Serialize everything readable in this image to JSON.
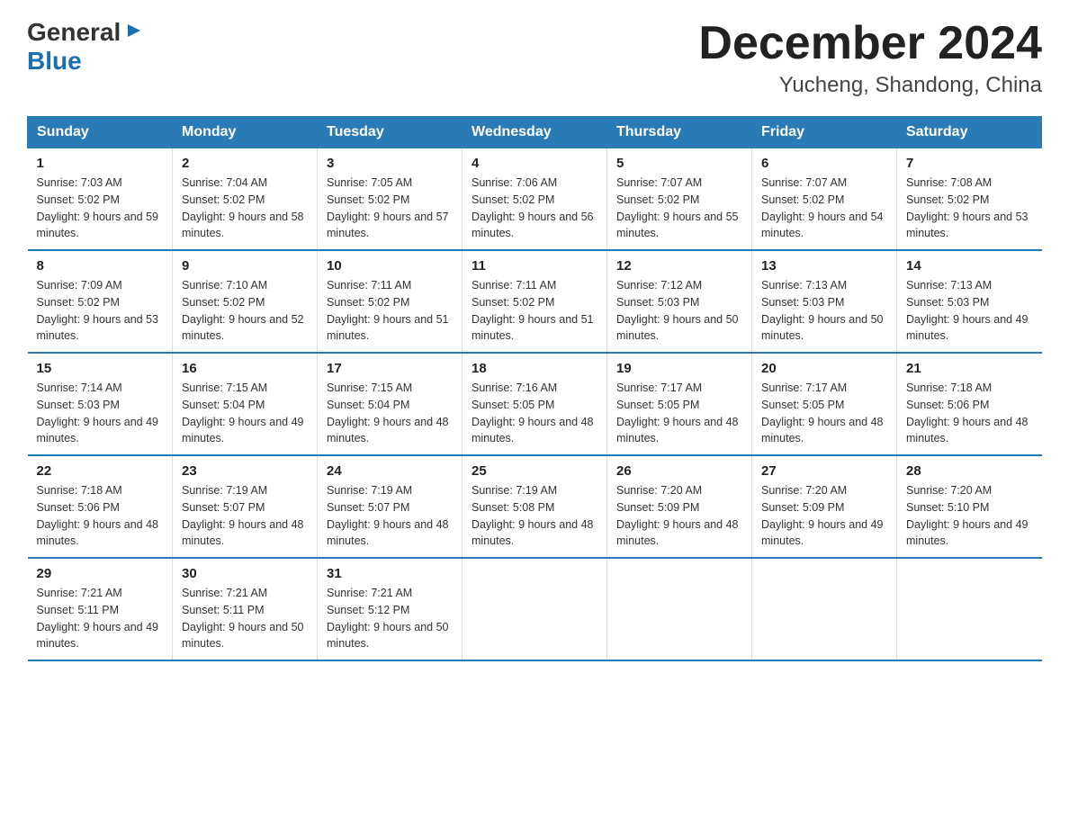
{
  "logo": {
    "general": "General",
    "blue": "Blue",
    "arrow": "▶"
  },
  "title": "December 2024",
  "location": "Yucheng, Shandong, China",
  "days_of_week": [
    "Sunday",
    "Monday",
    "Tuesday",
    "Wednesday",
    "Thursday",
    "Friday",
    "Saturday"
  ],
  "weeks": [
    [
      {
        "day": "1",
        "sunrise": "7:03 AM",
        "sunset": "5:02 PM",
        "daylight": "9 hours and 59 minutes."
      },
      {
        "day": "2",
        "sunrise": "7:04 AM",
        "sunset": "5:02 PM",
        "daylight": "9 hours and 58 minutes."
      },
      {
        "day": "3",
        "sunrise": "7:05 AM",
        "sunset": "5:02 PM",
        "daylight": "9 hours and 57 minutes."
      },
      {
        "day": "4",
        "sunrise": "7:06 AM",
        "sunset": "5:02 PM",
        "daylight": "9 hours and 56 minutes."
      },
      {
        "day": "5",
        "sunrise": "7:07 AM",
        "sunset": "5:02 PM",
        "daylight": "9 hours and 55 minutes."
      },
      {
        "day": "6",
        "sunrise": "7:07 AM",
        "sunset": "5:02 PM",
        "daylight": "9 hours and 54 minutes."
      },
      {
        "day": "7",
        "sunrise": "7:08 AM",
        "sunset": "5:02 PM",
        "daylight": "9 hours and 53 minutes."
      }
    ],
    [
      {
        "day": "8",
        "sunrise": "7:09 AM",
        "sunset": "5:02 PM",
        "daylight": "9 hours and 53 minutes."
      },
      {
        "day": "9",
        "sunrise": "7:10 AM",
        "sunset": "5:02 PM",
        "daylight": "9 hours and 52 minutes."
      },
      {
        "day": "10",
        "sunrise": "7:11 AM",
        "sunset": "5:02 PM",
        "daylight": "9 hours and 51 minutes."
      },
      {
        "day": "11",
        "sunrise": "7:11 AM",
        "sunset": "5:02 PM",
        "daylight": "9 hours and 51 minutes."
      },
      {
        "day": "12",
        "sunrise": "7:12 AM",
        "sunset": "5:03 PM",
        "daylight": "9 hours and 50 minutes."
      },
      {
        "day": "13",
        "sunrise": "7:13 AM",
        "sunset": "5:03 PM",
        "daylight": "9 hours and 50 minutes."
      },
      {
        "day": "14",
        "sunrise": "7:13 AM",
        "sunset": "5:03 PM",
        "daylight": "9 hours and 49 minutes."
      }
    ],
    [
      {
        "day": "15",
        "sunrise": "7:14 AM",
        "sunset": "5:03 PM",
        "daylight": "9 hours and 49 minutes."
      },
      {
        "day": "16",
        "sunrise": "7:15 AM",
        "sunset": "5:04 PM",
        "daylight": "9 hours and 49 minutes."
      },
      {
        "day": "17",
        "sunrise": "7:15 AM",
        "sunset": "5:04 PM",
        "daylight": "9 hours and 48 minutes."
      },
      {
        "day": "18",
        "sunrise": "7:16 AM",
        "sunset": "5:05 PM",
        "daylight": "9 hours and 48 minutes."
      },
      {
        "day": "19",
        "sunrise": "7:17 AM",
        "sunset": "5:05 PM",
        "daylight": "9 hours and 48 minutes."
      },
      {
        "day": "20",
        "sunrise": "7:17 AM",
        "sunset": "5:05 PM",
        "daylight": "9 hours and 48 minutes."
      },
      {
        "day": "21",
        "sunrise": "7:18 AM",
        "sunset": "5:06 PM",
        "daylight": "9 hours and 48 minutes."
      }
    ],
    [
      {
        "day": "22",
        "sunrise": "7:18 AM",
        "sunset": "5:06 PM",
        "daylight": "9 hours and 48 minutes."
      },
      {
        "day": "23",
        "sunrise": "7:19 AM",
        "sunset": "5:07 PM",
        "daylight": "9 hours and 48 minutes."
      },
      {
        "day": "24",
        "sunrise": "7:19 AM",
        "sunset": "5:07 PM",
        "daylight": "9 hours and 48 minutes."
      },
      {
        "day": "25",
        "sunrise": "7:19 AM",
        "sunset": "5:08 PM",
        "daylight": "9 hours and 48 minutes."
      },
      {
        "day": "26",
        "sunrise": "7:20 AM",
        "sunset": "5:09 PM",
        "daylight": "9 hours and 48 minutes."
      },
      {
        "day": "27",
        "sunrise": "7:20 AM",
        "sunset": "5:09 PM",
        "daylight": "9 hours and 49 minutes."
      },
      {
        "day": "28",
        "sunrise": "7:20 AM",
        "sunset": "5:10 PM",
        "daylight": "9 hours and 49 minutes."
      }
    ],
    [
      {
        "day": "29",
        "sunrise": "7:21 AM",
        "sunset": "5:11 PM",
        "daylight": "9 hours and 49 minutes."
      },
      {
        "day": "30",
        "sunrise": "7:21 AM",
        "sunset": "5:11 PM",
        "daylight": "9 hours and 50 minutes."
      },
      {
        "day": "31",
        "sunrise": "7:21 AM",
        "sunset": "5:12 PM",
        "daylight": "9 hours and 50 minutes."
      },
      null,
      null,
      null,
      null
    ]
  ]
}
